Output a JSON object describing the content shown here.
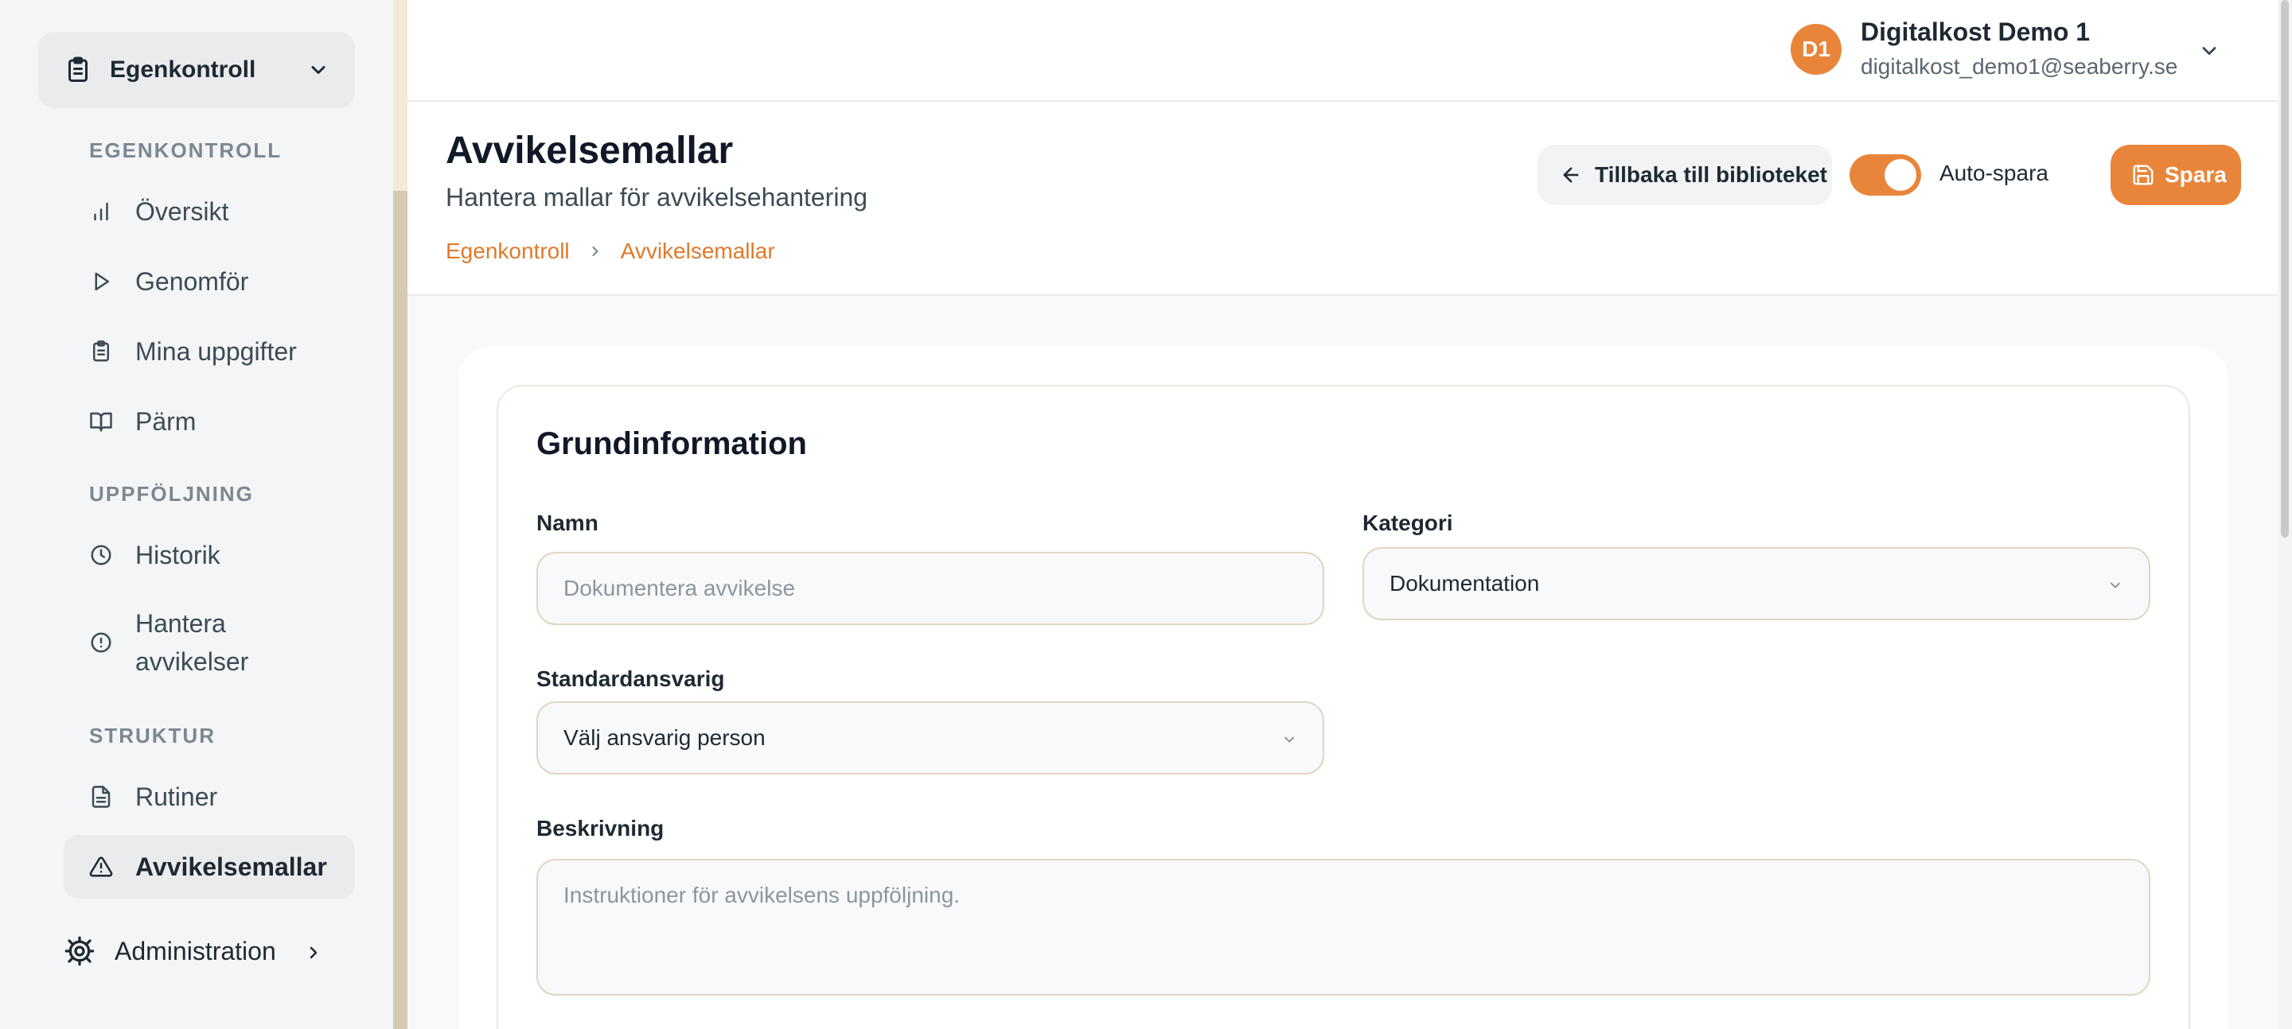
{
  "sidebar": {
    "group": {
      "label": "Egenkontroll",
      "icon": "clipboard-icon"
    },
    "sections": [
      {
        "label": "EGENKONTROLL"
      },
      {
        "label": "UPPFÖLJNING"
      },
      {
        "label": "STRUKTUR"
      }
    ],
    "items": [
      {
        "label": "Översikt",
        "icon": "bar-chart-icon"
      },
      {
        "label": "Genomför",
        "icon": "play-icon"
      },
      {
        "label": "Mina uppgifter",
        "icon": "clipboard-icon"
      },
      {
        "label": "Pärm",
        "icon": "book-icon"
      },
      {
        "label": "Historik",
        "icon": "clock-icon"
      },
      {
        "label": "Hantera avvikelser",
        "icon": "alert-circle-icon"
      },
      {
        "label": "Rutiner",
        "icon": "file-text-icon"
      },
      {
        "label": "Avvikelsemallar",
        "icon": "warning-triangle-icon",
        "active": true
      }
    ],
    "admin": {
      "label": "Administration",
      "icon": "gear-icon"
    }
  },
  "user": {
    "initials": "D1",
    "name": "Digitalkost Demo 1",
    "email": "digitalkost_demo1@seaberry.se"
  },
  "header": {
    "title": "Avvikelsemallar",
    "subtitle": "Hantera mallar för avvikelsehantering",
    "breadcrumb": [
      "Egenkontroll",
      "Avvikelsemallar"
    ],
    "back_label": "Tillbaka till biblioteket",
    "autosave_label": "Auto-spara",
    "autosave_on": true,
    "save_label": "Spara"
  },
  "form": {
    "section_title": "Grundinformation",
    "name": {
      "label": "Namn",
      "placeholder": "Dokumentera avvikelse",
      "value": ""
    },
    "category": {
      "label": "Kategori",
      "value": "Dokumentation"
    },
    "responsible": {
      "label": "Standardansvarig",
      "value": "Välj ansvarig person"
    },
    "description": {
      "label": "Beskrivning",
      "placeholder": "Instruktioner för avvikelsens uppföljning.",
      "value": ""
    }
  },
  "colors": {
    "accent": "#e9853a",
    "breadcrumb": "#e07a2b",
    "sidebar_bg": "#f4f5f6",
    "text": "#1f2933"
  }
}
